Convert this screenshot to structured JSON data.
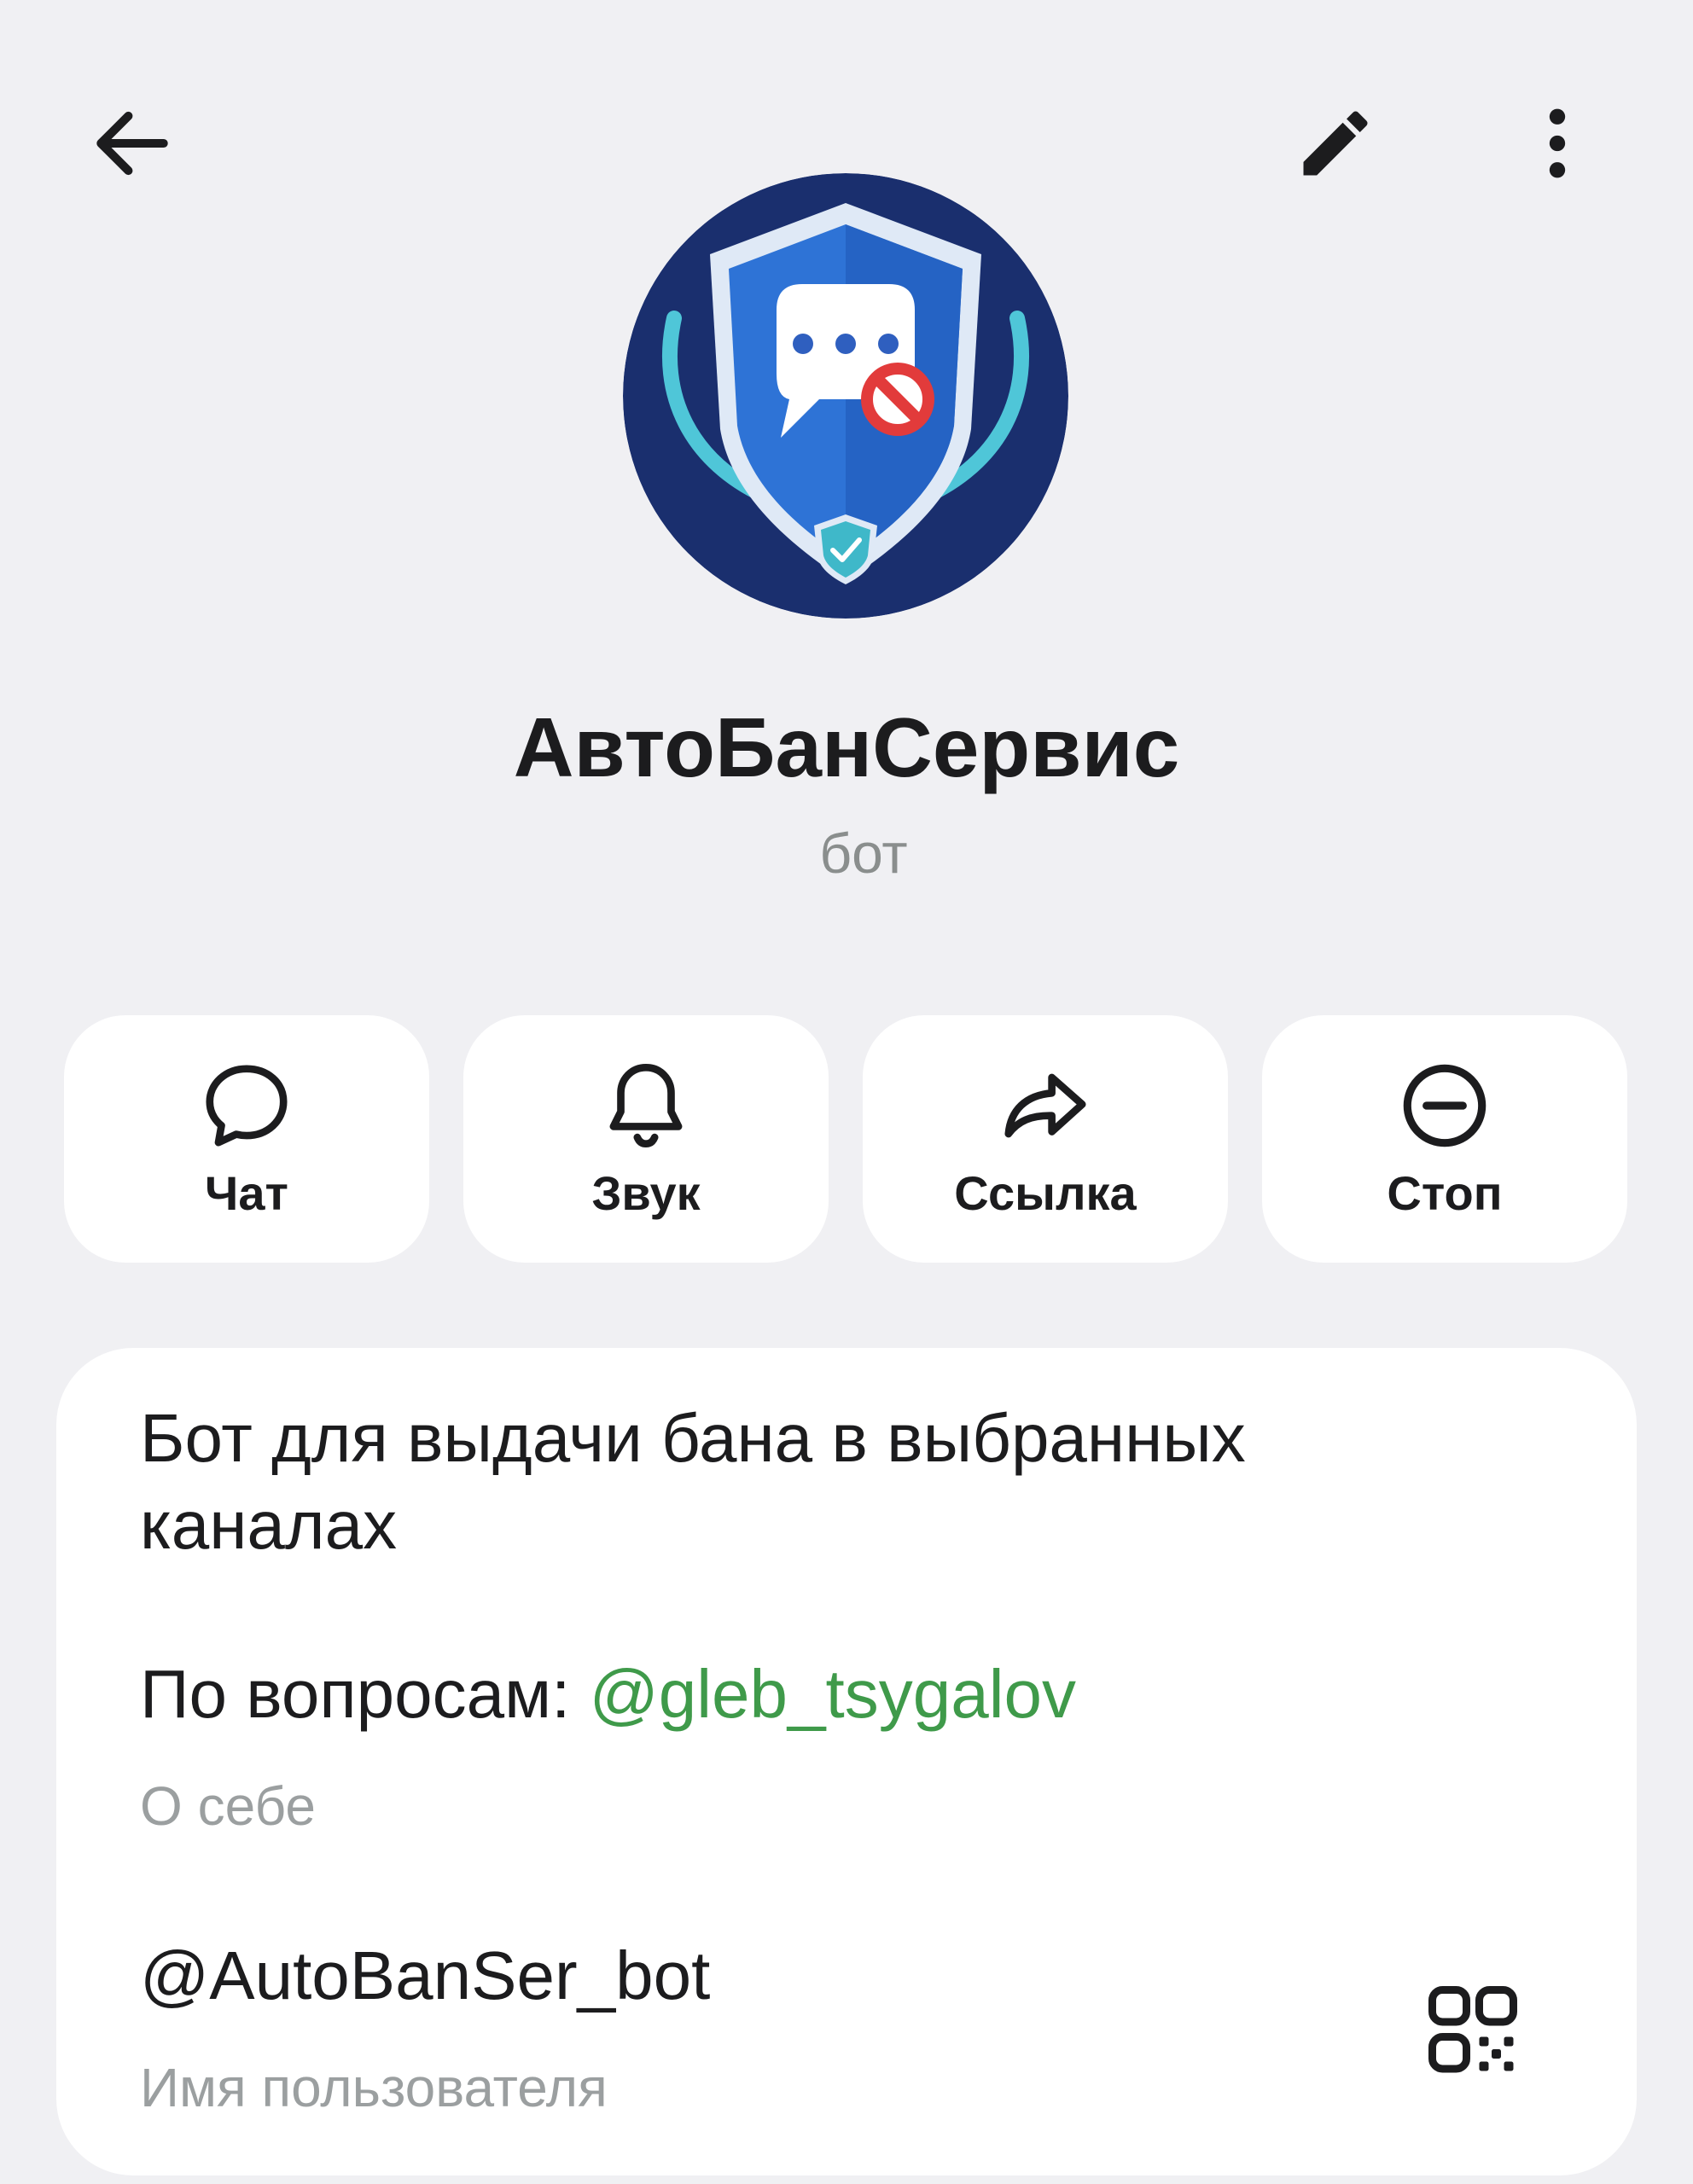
{
  "header": {
    "back_icon": "arrow-left-icon",
    "edit_icon": "pencil-icon",
    "more_icon": "more-vertical-icon"
  },
  "profile": {
    "name": "АвтоБанСервис",
    "type": "бот",
    "avatar_icon": "shield-chat-ban-icon"
  },
  "actions": [
    {
      "label": "Чат",
      "icon": "chat-bubble-icon"
    },
    {
      "label": "Звук",
      "icon": "bell-icon"
    },
    {
      "label": "Ссылка",
      "icon": "share-icon"
    },
    {
      "label": "Стоп",
      "icon": "stop-icon"
    }
  ],
  "info": {
    "description": "Бот для выдачи бана в выбранных каналах",
    "contact_prefix": "По вопросам: ",
    "contact_link": "@gleb_tsygalov",
    "description_caption": "О себе",
    "username": "@AutoBanSer_bot",
    "username_caption": "Имя пользователя",
    "qr_icon": "qr-code-icon"
  },
  "colors": {
    "background": "#f0f0f3",
    "card": "#ffffff",
    "link": "#3f9a4a",
    "secondary_text": "#9b9fa0"
  }
}
